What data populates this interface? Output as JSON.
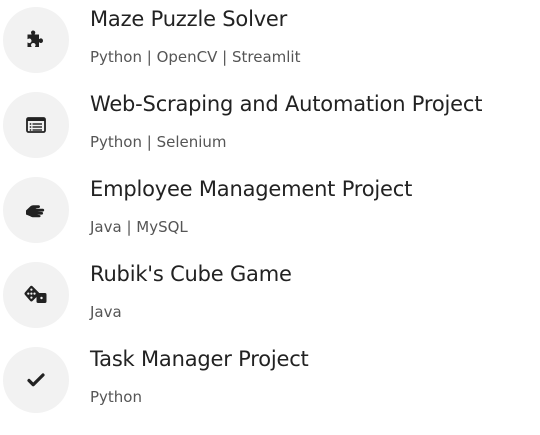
{
  "projects": [
    {
      "title": "Maze Puzzle Solver",
      "tech": "Python | OpenCV | Streamlit",
      "icon": "puzzle-piece-icon"
    },
    {
      "title": "Web-Scraping and Automation Project",
      "tech": "Python | Selenium",
      "icon": "list-window-icon"
    },
    {
      "title": "Employee Management Project",
      "tech": "Java | MySQL",
      "icon": "handshake-icon"
    },
    {
      "title": "Rubik's Cube Game",
      "tech": "Java",
      "icon": "dice-icon"
    },
    {
      "title": "Task Manager Project",
      "tech": "Python",
      "icon": "checkmark-icon"
    }
  ],
  "colors": {
    "icon_background": "#f2f2f2",
    "icon_color": "#222222",
    "title_color": "#222222",
    "tech_color": "#555555"
  }
}
